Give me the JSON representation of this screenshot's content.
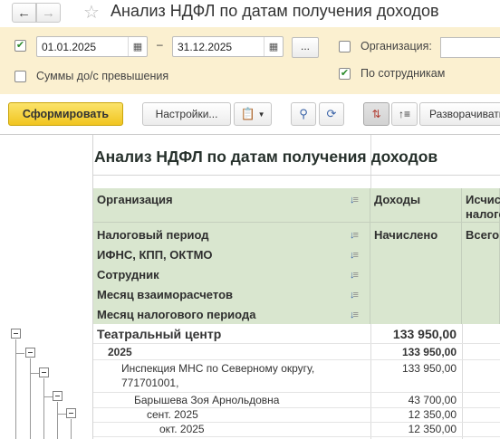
{
  "header": {
    "title": "Анализ НДФЛ по датам получения доходов",
    "back_icon": "arrow-left-icon",
    "forward_icon": "arrow-right-icon",
    "favorite_icon": "star-icon"
  },
  "params": {
    "period_enabled": true,
    "date_from": "01.01.2025",
    "date_to": "31.12.2025",
    "date_separator": "–",
    "period_button": "...",
    "org_label": "Организация:",
    "org_checked": false,
    "org_value": "",
    "excess_label": "Суммы до/с превышения",
    "excess_checked": false,
    "by_employees_label": "По сотрудникам",
    "by_employees_checked": true
  },
  "toolbar": {
    "generate_label": "Сформировать",
    "settings_label": "Настройки...",
    "expand_label": "Разворачивать"
  },
  "report": {
    "title": "Анализ НДФЛ по датам получения доходов",
    "group_headers": [
      "Организация",
      "Налоговый период",
      "ИФНС, КПП, ОКТМО",
      "Сотрудник",
      "Месяц взаиморасчетов",
      "Месяц налогового периода"
    ],
    "col_income": "Доходы",
    "col_accrued": "Начислено",
    "col_calc": "Исчис налого",
    "col_total": "Всего",
    "rows": [
      {
        "label": "Театральный центр",
        "value": "133 950,00"
      },
      {
        "label": "2025",
        "value": "133 950,00"
      },
      {
        "label": "Инспекция МНС по Северному округу,",
        "label2": "771701001,",
        "value": "133 950,00"
      },
      {
        "label": "Барышева Зоя Арнольдовна",
        "value": "43 700,00"
      },
      {
        "label": "сент. 2025",
        "value": "12 350,00"
      },
      {
        "label": "окт. 2025",
        "value": "12 350,00"
      }
    ]
  },
  "colors": {
    "accent_yellow": "#f1c520",
    "param_bg": "#fbf0d0",
    "header_green": "#d9e6cf"
  }
}
